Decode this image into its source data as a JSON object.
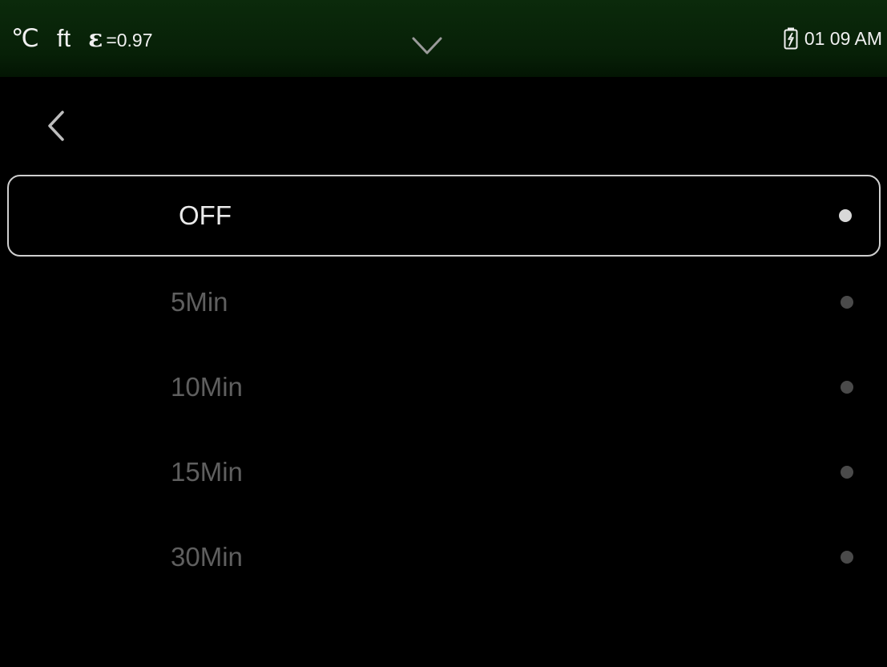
{
  "status_bar": {
    "temp_unit": "℃",
    "distance_unit": "ft",
    "emissivity_symbol": "ε",
    "emissivity_value": "=0.97",
    "time": "01 09 AM",
    "battery_state": "charging"
  },
  "options": [
    {
      "label": "OFF",
      "selected": true
    },
    {
      "label": "5Min",
      "selected": false
    },
    {
      "label": "10Min",
      "selected": false
    },
    {
      "label": "15Min",
      "selected": false
    },
    {
      "label": "30Min",
      "selected": false
    }
  ],
  "icons": {
    "dropdown": "chevron-down-icon",
    "back": "chevron-left-icon",
    "battery": "battery-charging-icon"
  },
  "colors": {
    "status_bar": "#072007",
    "selected_text": "#eaeaea",
    "unselected_text": "#5f5f5f",
    "selected_border": "#cfcfcf",
    "selected_dot": "#d8d8d8",
    "unselected_dot": "#4a4a4a"
  }
}
